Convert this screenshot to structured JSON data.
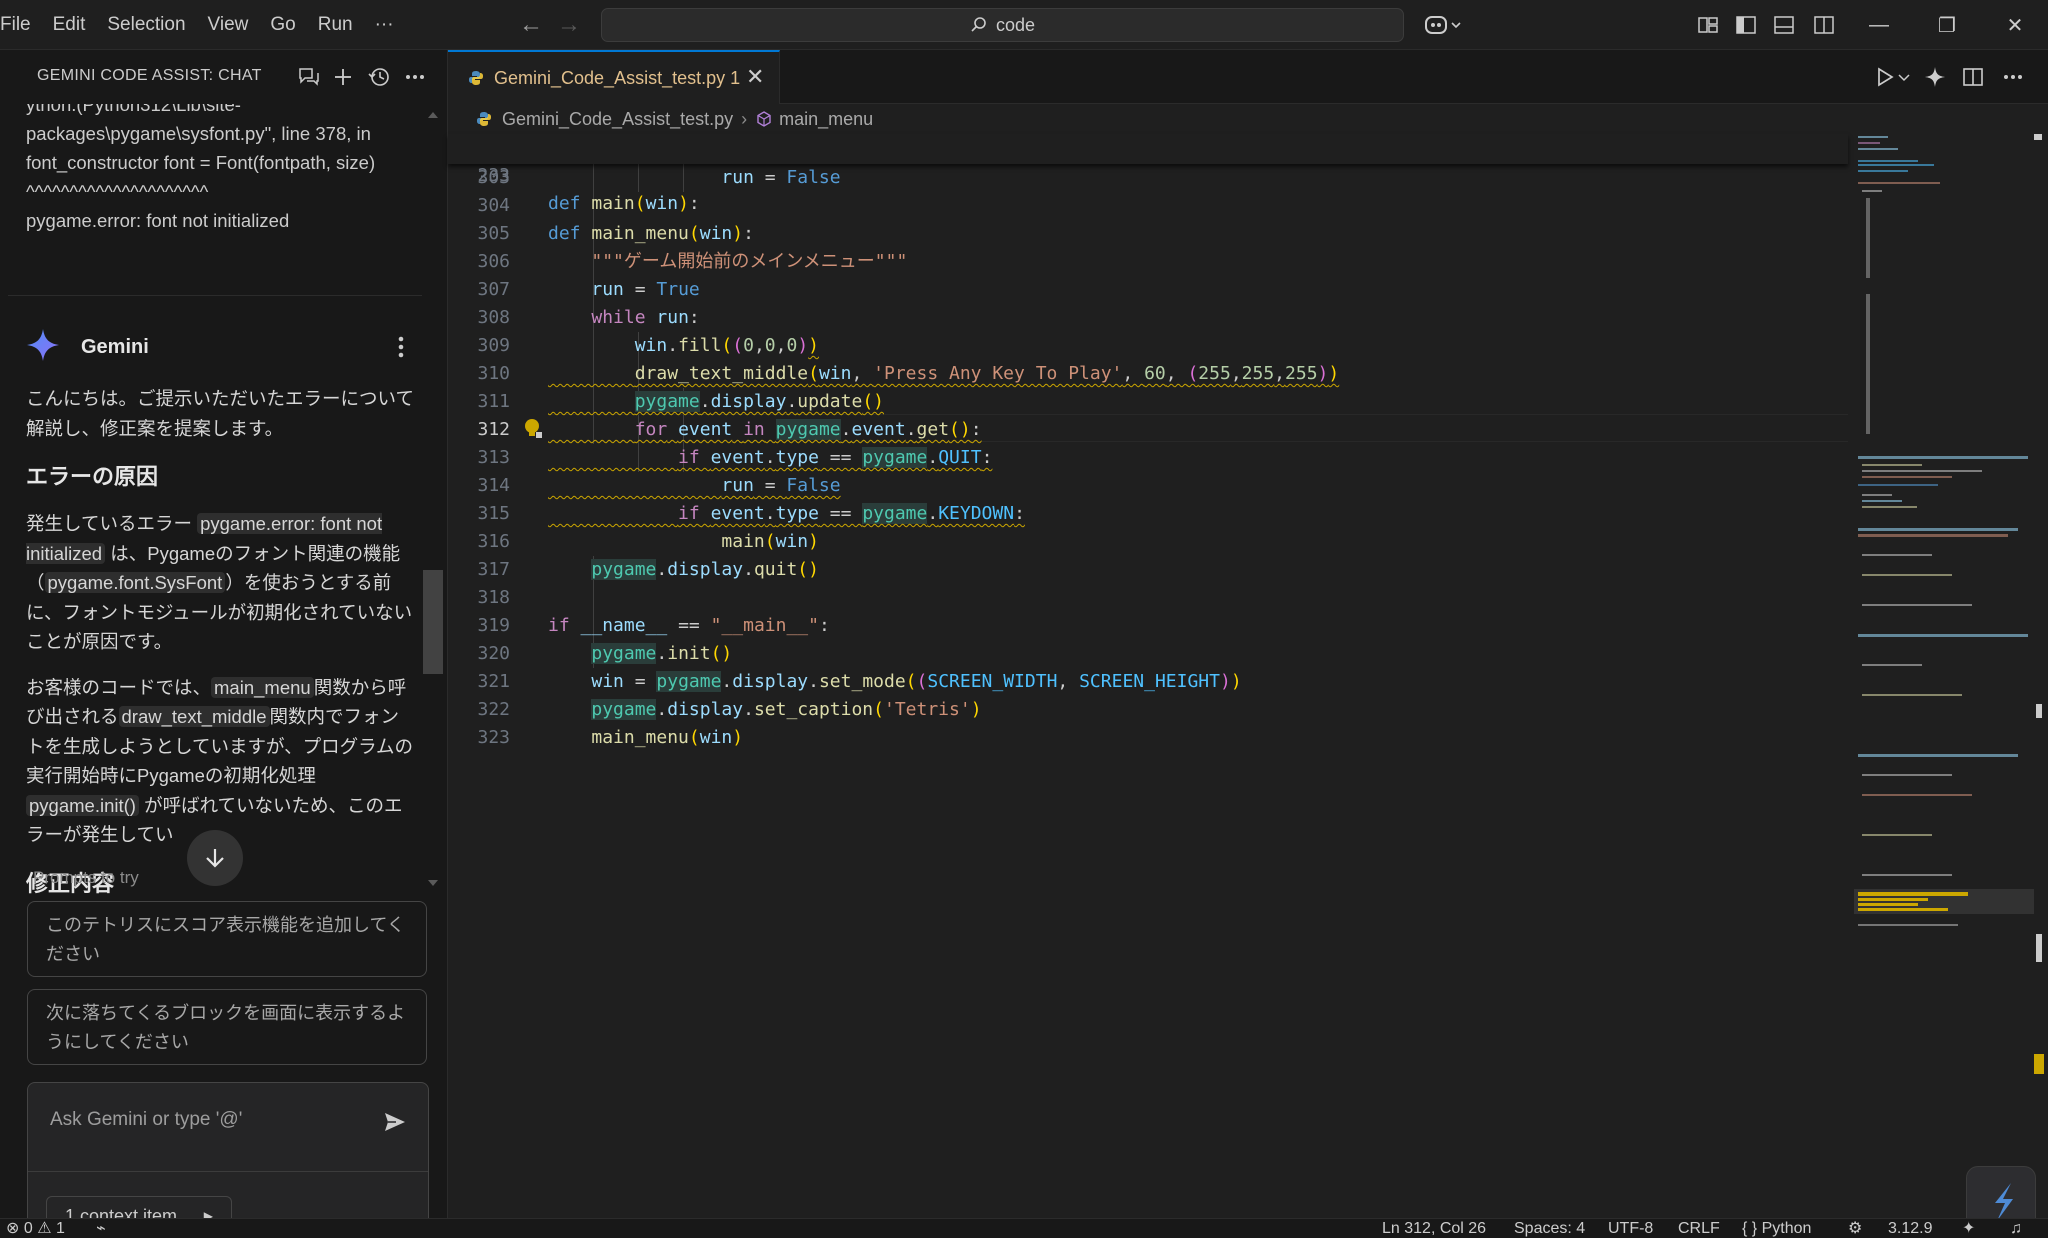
{
  "menu": {
    "items": [
      "File",
      "Edit",
      "Selection",
      "View",
      "Go",
      "Run"
    ],
    "more": "···"
  },
  "command_center": {
    "text": "code"
  },
  "window_controls": {
    "minimize": "—",
    "restore": "❐",
    "close": "✕"
  },
  "chat_panel": {
    "title": "GEMINI CODE ASSIST: CHAT",
    "error_lines": [
      "ython.(Python312\\Lib\\site-",
      "packages\\pygame\\sysfont.py\", line 378, in",
      "font_constructor font = Font(fontpath, size)",
      "^^^^^^^^^^^^^^^^^^^^^",
      "pygame.error: font not initialized"
    ],
    "assistant_name": "Gemini",
    "intro": "こんにちは。ご提示いただいたエラーについて解説し、修正案を提案します。",
    "heading_cause": "エラーの原因",
    "para1": {
      "t1": "発生しているエラー ",
      "code1": "pygame.error: font not initialized",
      "t2": " は、Pygameのフォント関連の機能（",
      "code2": "pygame.font.SysFont",
      "t3": "）を使おうとする前に、フォントモジュールが初期化されていないことが原因です。"
    },
    "para2": {
      "t1": "お客様のコードでは、",
      "code1": "main_menu",
      "t2": "関数から呼び出される",
      "code2": "draw_text_middle",
      "t3": "関数内でフォントを生成しようとしていますが、プログラムの実行開始時にPygameの初期化処理",
      "code3": "pygame.init()",
      "t4": " が呼ばれていないため、このエラーが発生してい"
    },
    "heading_fix": "修正内容",
    "prompts_label": "Prompts to try",
    "prompts": [
      "このテトリスにスコア表示機能を追加してください",
      "次に落ちてくるブロックを画面に表示するようにしてください"
    ],
    "input_placeholder": "Ask Gemini or type '@'",
    "context_button": "1 context item"
  },
  "editor": {
    "tab": {
      "name": "Gemini_Code_Assist_test.py",
      "problems": "1"
    },
    "breadcrumb": {
      "file": "Gemini_Code_Assist_test.py",
      "symbol": "main_menu"
    },
    "sticky": {
      "ln": "233",
      "code": "def main(win):"
    },
    "lines": [
      "303",
      "304",
      "305",
      "306",
      "307",
      "308",
      "309",
      "310",
      "311",
      "312",
      "313",
      "314",
      "315",
      "316",
      "317",
      "318",
      "319",
      "320",
      "321",
      "322",
      "323"
    ],
    "active_line": "312"
  },
  "status": {
    "errors": "0",
    "warnings": "1",
    "position": "Ln 312, Col 26",
    "spaces": "Spaces: 4",
    "encoding": "UTF-8",
    "eol": "CRLF",
    "language": "Python",
    "python_version": "3.12.9"
  },
  "icons": {
    "new_chat": "chat-icon",
    "add": "plus-icon",
    "history": "history-icon",
    "more": "ellipsis-icon",
    "run": "play-icon",
    "split": "split-editor-icon",
    "gemini": "sparkle-icon"
  },
  "colors": {
    "accent": "#0078d4",
    "warning": "#cca700",
    "gemini": "#4285f4"
  }
}
